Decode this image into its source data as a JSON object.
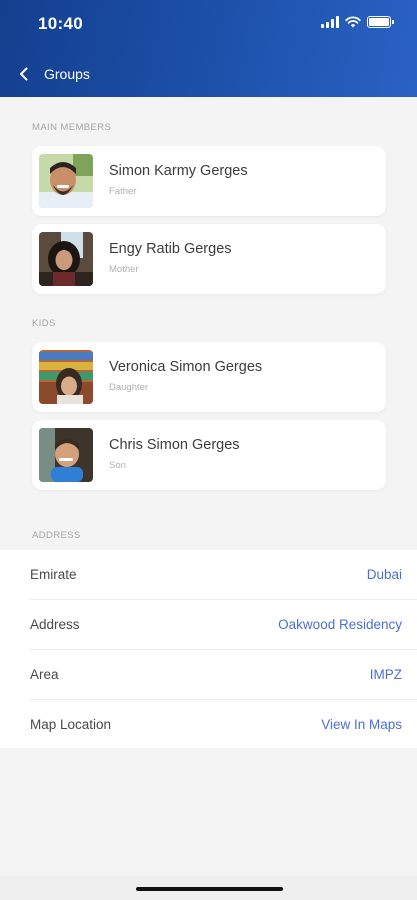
{
  "status_bar": {
    "time": "10:40"
  },
  "nav": {
    "back_label": "Groups"
  },
  "sections": {
    "main_members": "MAIN MEMBERS",
    "kids": "KIDS",
    "address": "ADDRESS"
  },
  "main_members": [
    {
      "name": "Simon Karmy Gerges",
      "role": "Father"
    },
    {
      "name": "Engy Ratib Gerges",
      "role": "Mother"
    }
  ],
  "kids": [
    {
      "name": "Veronica Simon Gerges",
      "role": "Daughter"
    },
    {
      "name": "Chris Simon Gerges",
      "role": "Son"
    }
  ],
  "address": [
    {
      "label": "Emirate",
      "value": "Dubai"
    },
    {
      "label": "Address",
      "value": "Oakwood Residency"
    },
    {
      "label": "Area",
      "value": "IMPZ"
    },
    {
      "label": "Map Location",
      "value": "View In Maps"
    }
  ],
  "colors": {
    "header": "#1b4ea6",
    "link": "#4b6fd0"
  },
  "icons": {
    "back": "chevron-left-icon",
    "signal": "cellular-signal-icon",
    "wifi": "wifi-icon",
    "battery": "battery-icon"
  }
}
